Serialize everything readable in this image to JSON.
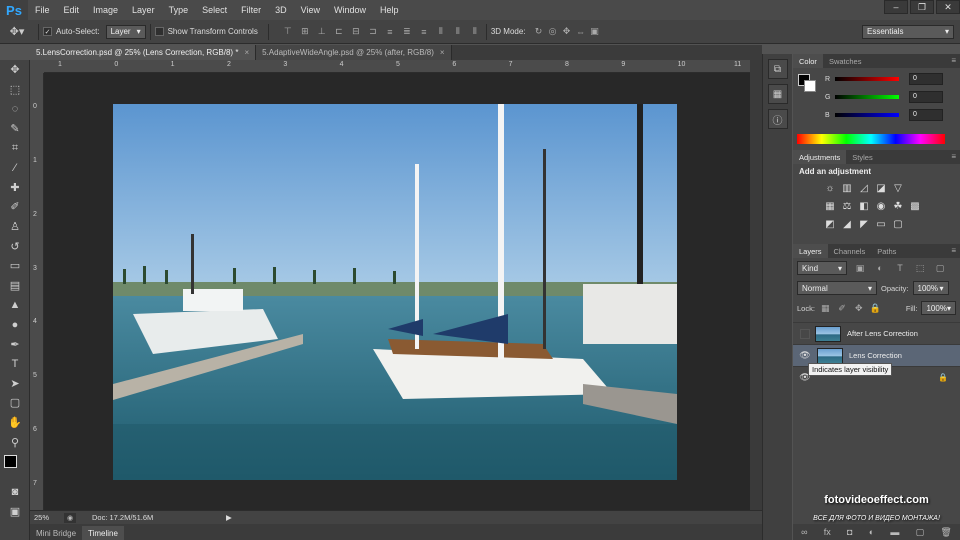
{
  "app": {
    "logo": "Ps"
  },
  "menu": [
    "File",
    "Edit",
    "Image",
    "Layer",
    "Type",
    "Select",
    "Filter",
    "3D",
    "View",
    "Window",
    "Help"
  ],
  "window_controls": [
    "–",
    "❐",
    "✕"
  ],
  "options_bar": {
    "auto_select_label": "Auto-Select:",
    "auto_select_value": "Layer",
    "transform_controls_label": "Show Transform Controls",
    "mode_3d_label": "3D Mode:",
    "workspace": "Essentials"
  },
  "doc_tabs": [
    {
      "label": "5.LensCorrection.psd @ 25% (Lens Correction, RGB/8) *",
      "active": true
    },
    {
      "label": "5.AdaptiveWideAngle.psd @ 25% (after, RGB/8)",
      "active": false
    }
  ],
  "ruler_top_ticks": [
    "1",
    "0",
    "1",
    "2",
    "3",
    "4",
    "5",
    "6",
    "7",
    "8",
    "9",
    "10",
    "11"
  ],
  "ruler_left_ticks": [
    "0",
    "1",
    "2",
    "3",
    "4",
    "5",
    "6",
    "7"
  ],
  "status": {
    "zoom": "25%",
    "doc": "Doc: 17.2M/51.6M"
  },
  "bottom_tabs": [
    "Mini Bridge",
    "Timeline"
  ],
  "color_panel": {
    "tabs": [
      "Color",
      "Swatches"
    ],
    "channels": [
      {
        "label": "R",
        "value": "0"
      },
      {
        "label": "G",
        "value": "0"
      },
      {
        "label": "B",
        "value": "0"
      }
    ]
  },
  "adjustments_panel": {
    "tabs": [
      "Adjustments",
      "Styles"
    ],
    "title": "Add an adjustment"
  },
  "layers_panel": {
    "tabs": [
      "Layers",
      "Channels",
      "Paths"
    ],
    "kind": "Kind",
    "blend_mode": "Normal",
    "opacity_label": "Opacity:",
    "opacity": "100%",
    "lock_label": "Lock:",
    "fill_label": "Fill:",
    "fill": "100%",
    "layers": [
      {
        "name": "After Lens Correction",
        "selected": false
      },
      {
        "name": "Lens Correction",
        "selected": true
      }
    ],
    "tooltip": "Indicates layer visibility"
  },
  "watermark": {
    "site": "fotovideoeffect.com",
    "tagline": "ВСЕ ДЛЯ ФОТО И ВИДЕО МОНТАЖА!"
  }
}
